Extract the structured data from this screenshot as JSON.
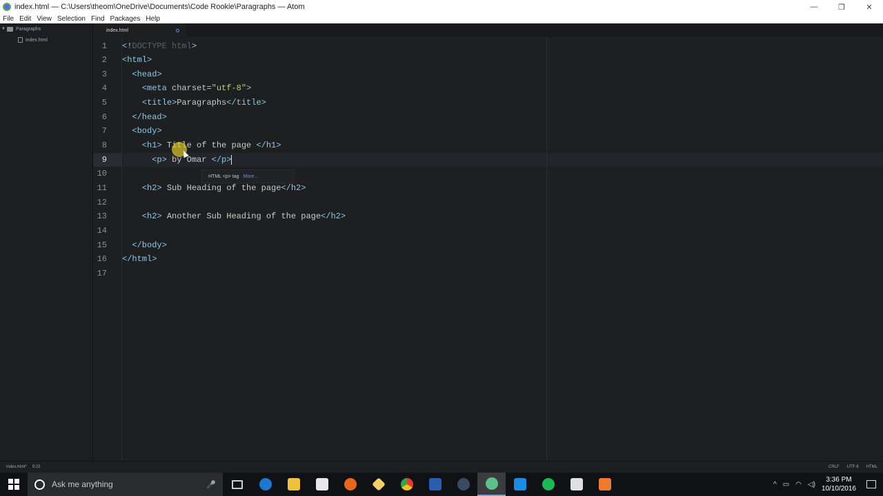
{
  "window": {
    "title": "index.html — C:\\Users\\theom\\OneDrive\\Documents\\Code Rookie\\Paragraphs — Atom",
    "minimize": "—",
    "restore": "❐",
    "close": "✕"
  },
  "menu": [
    "File",
    "Edit",
    "View",
    "Selection",
    "Find",
    "Packages",
    "Help"
  ],
  "tree": {
    "folder": "Paragraphs",
    "file": "index.html"
  },
  "tab": {
    "label": "index.html"
  },
  "editor": {
    "line_numbers": [
      "1",
      "2",
      "3",
      "4",
      "5",
      "6",
      "7",
      "8",
      "9",
      "10",
      "11",
      "12",
      "13",
      "14",
      "15",
      "16",
      "17"
    ],
    "active_line": 9,
    "lines": {
      "l1": {
        "open": "<!",
        "doctype": "DOCTYPE html",
        "close": ">"
      },
      "l2": "<html>",
      "l3": "<head>",
      "l4": {
        "open": "<meta ",
        "attr": "charset=",
        "value": "\"utf-8\"",
        "close": ">"
      },
      "l5": {
        "open": "<title>",
        "text": "Paragraphs",
        "close": "</title>"
      },
      "l6": "</head>",
      "l7": "<body>",
      "l8": {
        "open": "<h1>",
        "text": " Title of the page ",
        "close": "</h1>"
      },
      "l9": {
        "open": "<p>",
        "text": " by Omar ",
        "close": "</p>"
      },
      "l11": {
        "open": "<h2>",
        "text": " Sub Heading of the page",
        "close": "</h2>"
      },
      "l13": {
        "open": "<h2>",
        "text": " Another Sub Heading of the page",
        "close": "</h2>"
      },
      "l15": "</body>",
      "l16": "</html>"
    },
    "autocomplete": {
      "text": "HTML <p> tag",
      "more": "More..."
    }
  },
  "status": {
    "file": "index.html*",
    "cursor": "9:23",
    "line_ending": "CRLF",
    "encoding": "UTF-8",
    "grammar": "HTML"
  },
  "taskbar": {
    "search_placeholder": "Ask me anything",
    "time": "3:36 PM",
    "date": "10/10/2016",
    "apps": [
      {
        "name": "task-view",
        "color": "#cfcfcf"
      },
      {
        "name": "edge",
        "color": "#1e78d0"
      },
      {
        "name": "file-explorer",
        "color": "#f0c040"
      },
      {
        "name": "store",
        "color": "#e8e8e8"
      },
      {
        "name": "firefox",
        "color": "#e8671c"
      },
      {
        "name": "git",
        "color": "#f4cf6a"
      },
      {
        "name": "chrome",
        "color": "#e04030"
      },
      {
        "name": "powershell",
        "color": "#2a5db0"
      },
      {
        "name": "steam",
        "color": "#3a4a60"
      },
      {
        "name": "atom",
        "color": "#5fbf8a"
      },
      {
        "name": "outlook",
        "color": "#1c8ce0"
      },
      {
        "name": "spotify",
        "color": "#1db954"
      },
      {
        "name": "notes",
        "color": "#e0e0e0"
      },
      {
        "name": "video",
        "color": "#f07a30"
      }
    ]
  }
}
